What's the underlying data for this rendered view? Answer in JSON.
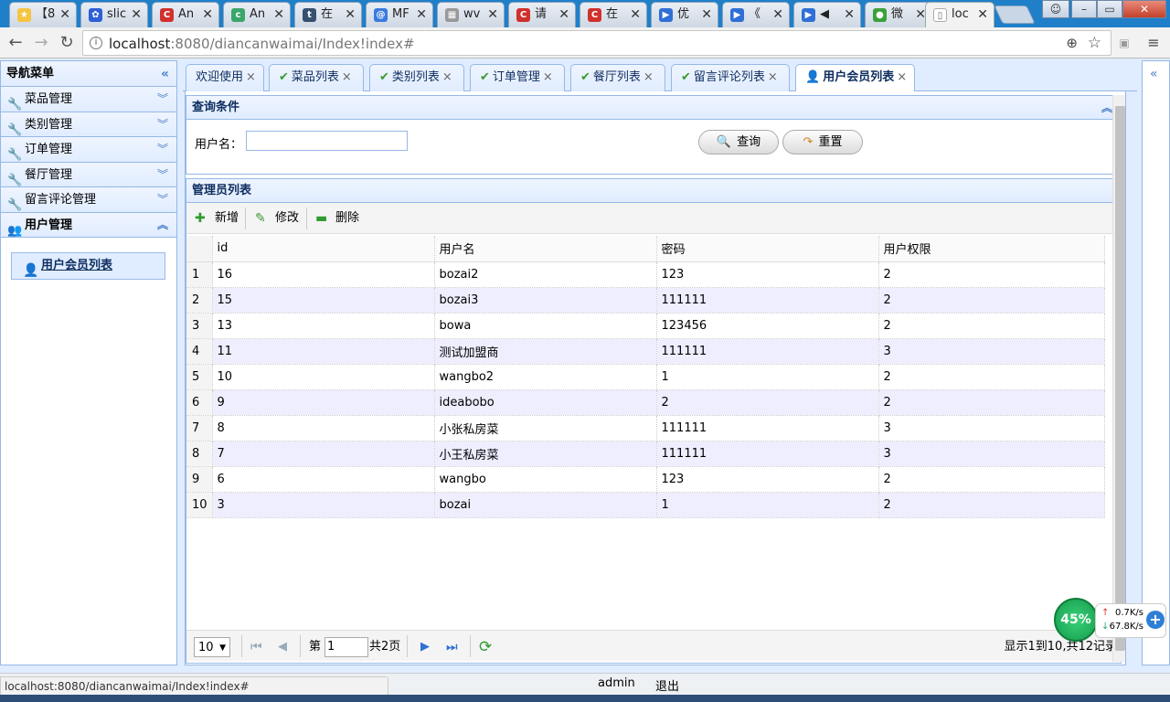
{
  "browser": {
    "tabs": [
      {
        "label": "【8",
        "color": "#f5c441",
        "glyph": "★"
      },
      {
        "label": "slic",
        "color": "#2e5fd6",
        "glyph": "✿"
      },
      {
        "label": "An",
        "color": "#d0312d",
        "glyph": "C"
      },
      {
        "label": "An",
        "color": "#3aa66a",
        "glyph": "c"
      },
      {
        "label": "在",
        "color": "#35516f",
        "glyph": "t"
      },
      {
        "label": "MF",
        "color": "#3b7be0",
        "glyph": "@"
      },
      {
        "label": "wv",
        "color": "#999999",
        "glyph": "▦"
      },
      {
        "label": "请",
        "color": "#d0312d",
        "glyph": "C"
      },
      {
        "label": "在",
        "color": "#d0312d",
        "glyph": "C"
      },
      {
        "label": "优",
        "color": "#2f6fd6",
        "glyph": "▶"
      },
      {
        "label": "《",
        "color": "#2f6fd6",
        "glyph": "▶"
      },
      {
        "label": "◀",
        "color": "#2f6fd6",
        "glyph": "▶"
      },
      {
        "label": "微",
        "color": "#3aa13a",
        "glyph": "●"
      },
      {
        "label": "loc",
        "color": "#ffffff",
        "glyph": "▯"
      }
    ],
    "url_host": "localhost",
    "url_rest": ":8080/diancanwaimai/Index!index#",
    "status_url": "localhost:8080/diancanwaimai/Index!index#"
  },
  "sidebar": {
    "title": "导航菜单",
    "items": [
      {
        "label": "菜品管理"
      },
      {
        "label": "类别管理"
      },
      {
        "label": "订单管理"
      },
      {
        "label": "餐厅管理"
      },
      {
        "label": "留言评论管理"
      },
      {
        "label": "用户管理"
      }
    ],
    "sub_item": "用户会员列表"
  },
  "tabs": [
    "欢迎使用",
    "菜品列表",
    "类别列表",
    "订单管理",
    "餐厅列表",
    "留言评论列表",
    "用户会员列表"
  ],
  "query": {
    "title": "查询条件",
    "username_label": "用户名：",
    "username_value": "",
    "search_label": "查询",
    "reset_label": "重置"
  },
  "grid": {
    "title": "管理员列表",
    "add_label": "新增",
    "edit_label": "修改",
    "delete_label": "删除",
    "columns": [
      "id",
      "用户名",
      "密码",
      "用户权限"
    ],
    "rows": [
      [
        "16",
        "bozai2",
        "123",
        "2"
      ],
      [
        "15",
        "bozai3",
        "111111",
        "2"
      ],
      [
        "13",
        "bowa",
        "123456",
        "2"
      ],
      [
        "11",
        "测试加盟商",
        "111111",
        "3"
      ],
      [
        "10",
        "wangbo2",
        "1",
        "2"
      ],
      [
        "9",
        "ideabobo",
        "2",
        "2"
      ],
      [
        "8",
        "小张私房菜",
        "111111",
        "3"
      ],
      [
        "7",
        "小王私房菜",
        "111111",
        "3"
      ],
      [
        "6",
        "wangbo",
        "123",
        "2"
      ],
      [
        "3",
        "bozai",
        "1",
        "2"
      ]
    ]
  },
  "pager": {
    "page_size": "10",
    "page_prefix": "第",
    "page_value": "1",
    "page_total": "共2页",
    "info": "显示1到10,共12记录"
  },
  "footer": {
    "user": "admin",
    "logout": "退出"
  },
  "netmeter": {
    "percent": "45%",
    "up": "0.7K/s",
    "down": "67.8K/s"
  }
}
